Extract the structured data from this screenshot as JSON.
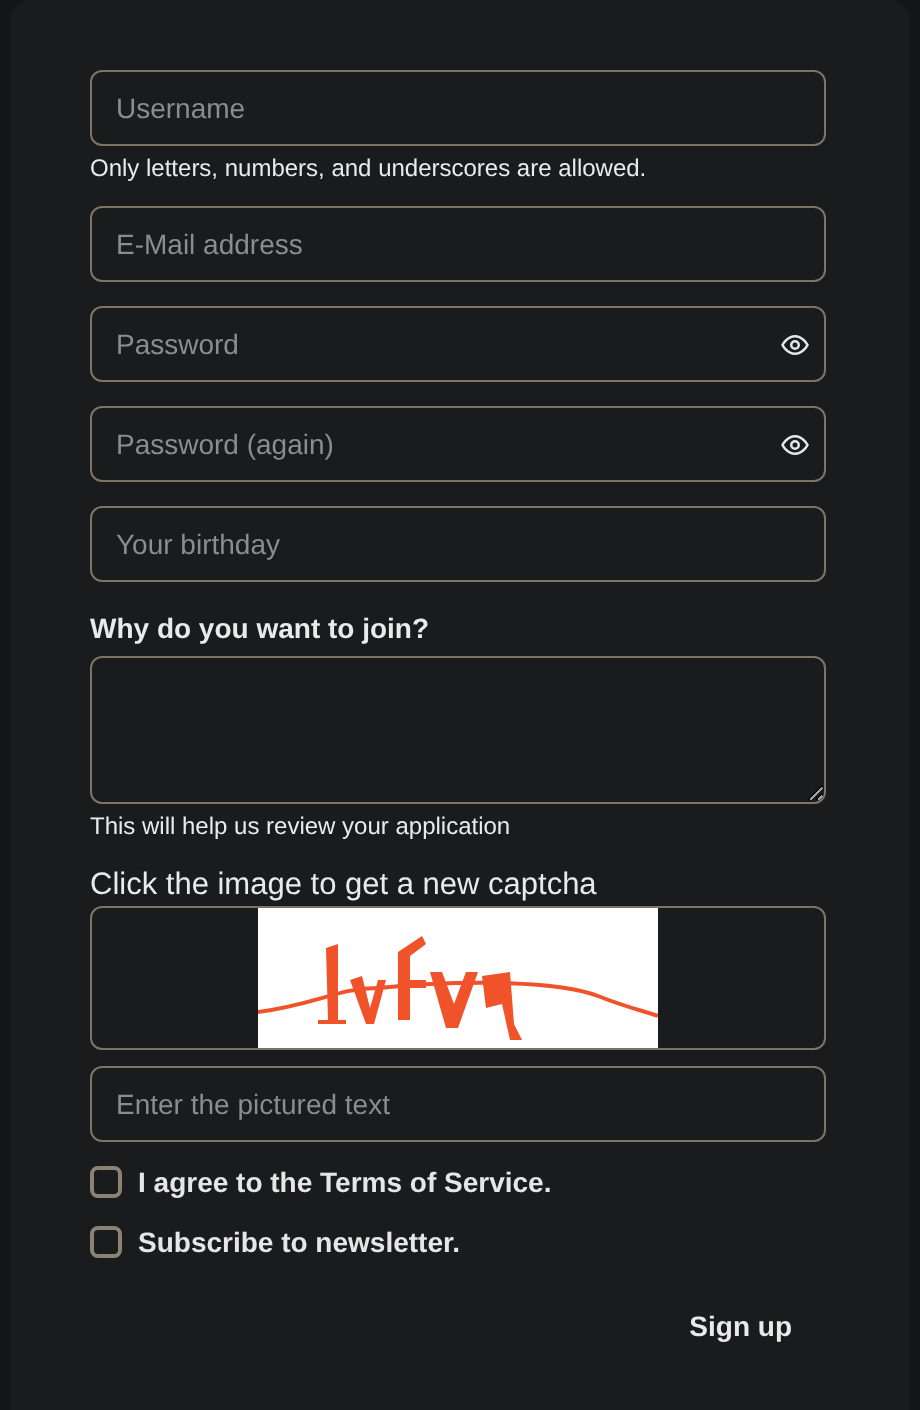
{
  "fields": [
    {
      "kind": "text",
      "placeholder": "Username",
      "help": "Only letters, numbers, and underscores are allowed."
    },
    {
      "kind": "text",
      "placeholder": "E-Mail address"
    },
    {
      "kind": "password",
      "placeholder": "Password"
    },
    {
      "kind": "password",
      "placeholder": "Password (again)"
    },
    {
      "kind": "text",
      "placeholder": "Your birthday"
    },
    {
      "kind": "textarea",
      "label": "Why do you want to join?",
      "help": "This will help us review your application"
    },
    {
      "kind": "captcha",
      "label": "Click the image to get a new captcha"
    },
    {
      "kind": "text",
      "placeholder": "Enter the pictured text"
    }
  ],
  "checkboxes": [
    {
      "label": "I agree to the Terms of Service.",
      "checked": false
    },
    {
      "label": "Subscribe to newsletter.",
      "checked": false
    }
  ],
  "submit": "Sign up"
}
